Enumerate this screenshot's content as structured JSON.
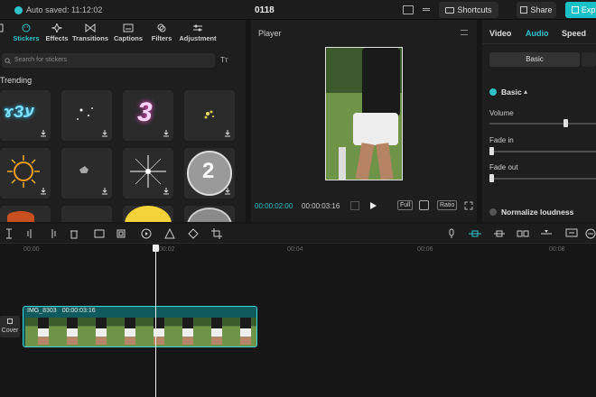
{
  "topbar": {
    "autosave": "Auto saved: 11:12:02",
    "title": "0118",
    "shortcuts": "Shortcuts",
    "share": "Share",
    "export": "Exp"
  },
  "left_panel": {
    "tabs": [
      {
        "label": "",
        "icon": "media-icon"
      },
      {
        "label": "Stickers",
        "icon": "sticker-icon",
        "active": true
      },
      {
        "label": "Effects",
        "icon": "effects-icon"
      },
      {
        "label": "Transitions",
        "icon": "transitions-icon"
      },
      {
        "label": "Captions",
        "icon": "captions-icon"
      },
      {
        "label": "Filters",
        "icon": "filters-icon"
      },
      {
        "label": "Adjustment",
        "icon": "adjustment-icon"
      }
    ],
    "search_placeholder": "Search for stickers",
    "filter_label": "Tт",
    "section": "Trending",
    "sticker_texts": {
      "three": "3",
      "two": "2",
      "letters": "ɤЗע"
    }
  },
  "player": {
    "title": "Player",
    "current_time": "00:00:02:00",
    "total_time": "00:00:03:16",
    "full": "Full",
    "ratio": "Ratio"
  },
  "right_panel": {
    "tabs": [
      "Video",
      "Audio",
      "Speed"
    ],
    "active_tab": "Audio",
    "subtab": "Basic",
    "basic": "Basic",
    "volume": "Volume",
    "volume_level": 0.9,
    "fade_in": "Fade in",
    "fade_out": "Fade out",
    "normalize": "Normalize loudness"
  },
  "timeline": {
    "ticks": [
      "00:00",
      "00:02",
      "00:04",
      "00:06",
      "00:08"
    ],
    "clip_name": "IMG_8303",
    "clip_duration": "00:00:03:16",
    "cover": "Cover"
  },
  "colors": {
    "accent": "#2fc2c9",
    "clip": "#0f5a5c"
  }
}
